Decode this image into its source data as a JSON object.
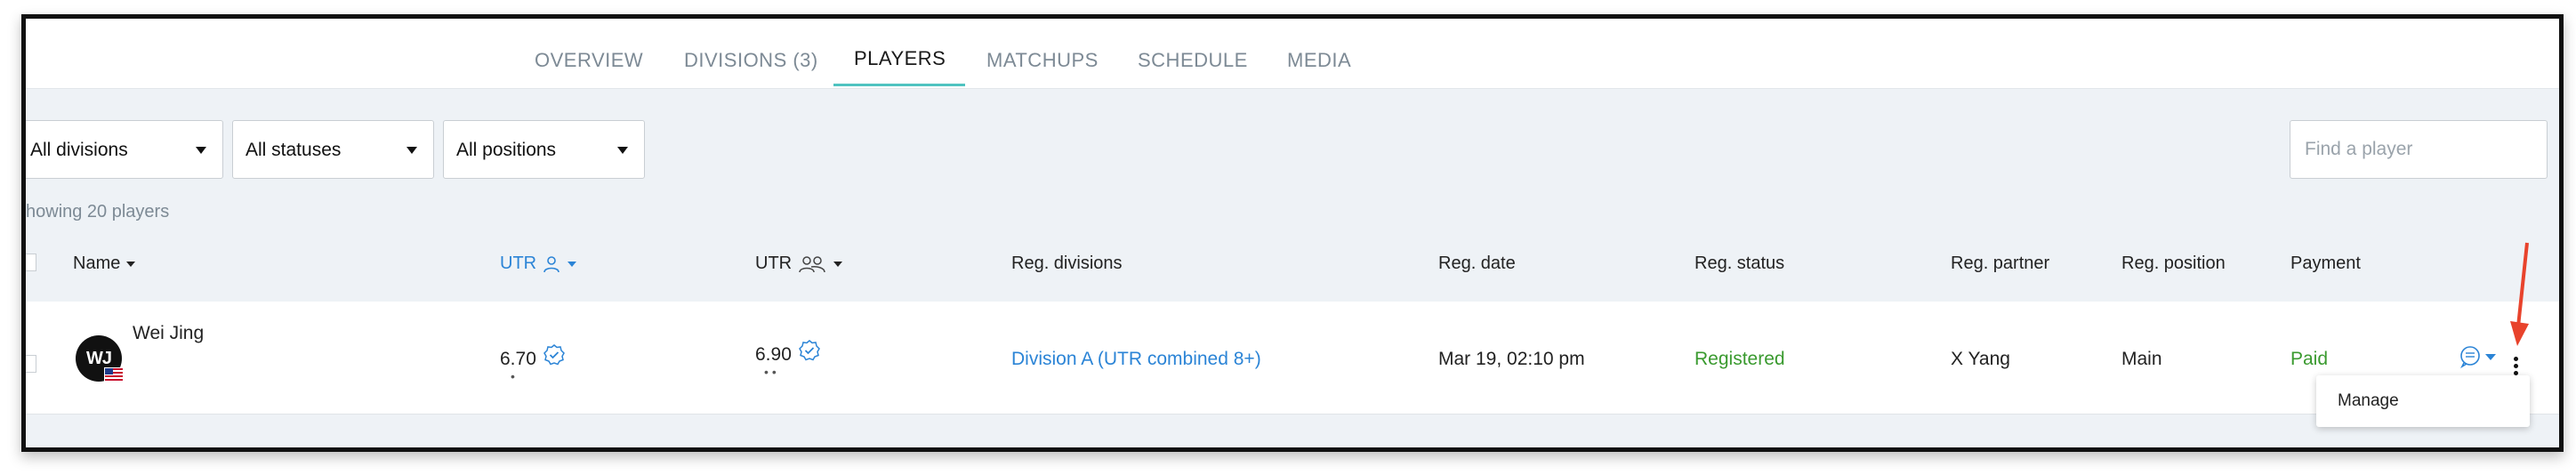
{
  "tabs": [
    {
      "label": "OVERVIEW"
    },
    {
      "label": "DIVISIONS (3)"
    },
    {
      "label": "PLAYERS"
    },
    {
      "label": "MATCHUPS"
    },
    {
      "label": "SCHEDULE"
    },
    {
      "label": "MEDIA"
    }
  ],
  "active_tab": "PLAYERS",
  "filters": {
    "divisions": "All divisions",
    "statuses": "All statuses",
    "positions": "All positions",
    "search_placeholder": "Find a player"
  },
  "showing_text": "howing 20 players",
  "columns": {
    "name": "Name",
    "utr_singles": "UTR",
    "utr_doubles": "UTR",
    "reg_divisions": "Reg. divisions",
    "reg_date": "Reg. date",
    "reg_status": "Reg. status",
    "reg_partner": "Reg. partner",
    "reg_position": "Reg. position",
    "payment": "Payment"
  },
  "rows": [
    {
      "initials": "WJ",
      "name": "Wei Jing",
      "utr_singles": "6.70",
      "utr_doubles": "6.90",
      "reg_division": "Division A (UTR combined 8+)",
      "reg_date": "Mar 19, 02:10 pm",
      "reg_status": "Registered",
      "reg_partner": "X Yang",
      "reg_position": "Main",
      "payment": "Paid"
    }
  ],
  "row_menu": {
    "manage": "Manage"
  },
  "icons": {
    "sort": "caret-down-icon",
    "utr_singles": "person-icon",
    "utr_doubles": "people-icon",
    "verified": "verified-badge-icon",
    "message": "message-icon",
    "more": "kebab-menu-icon",
    "annotation": "red-arrow-icon"
  },
  "colors": {
    "accent": "#4fc3c0",
    "link": "#2b84d6",
    "registered": "#3a9a2f",
    "paid": "#3a9a2f",
    "annotation": "#e8432c"
  }
}
